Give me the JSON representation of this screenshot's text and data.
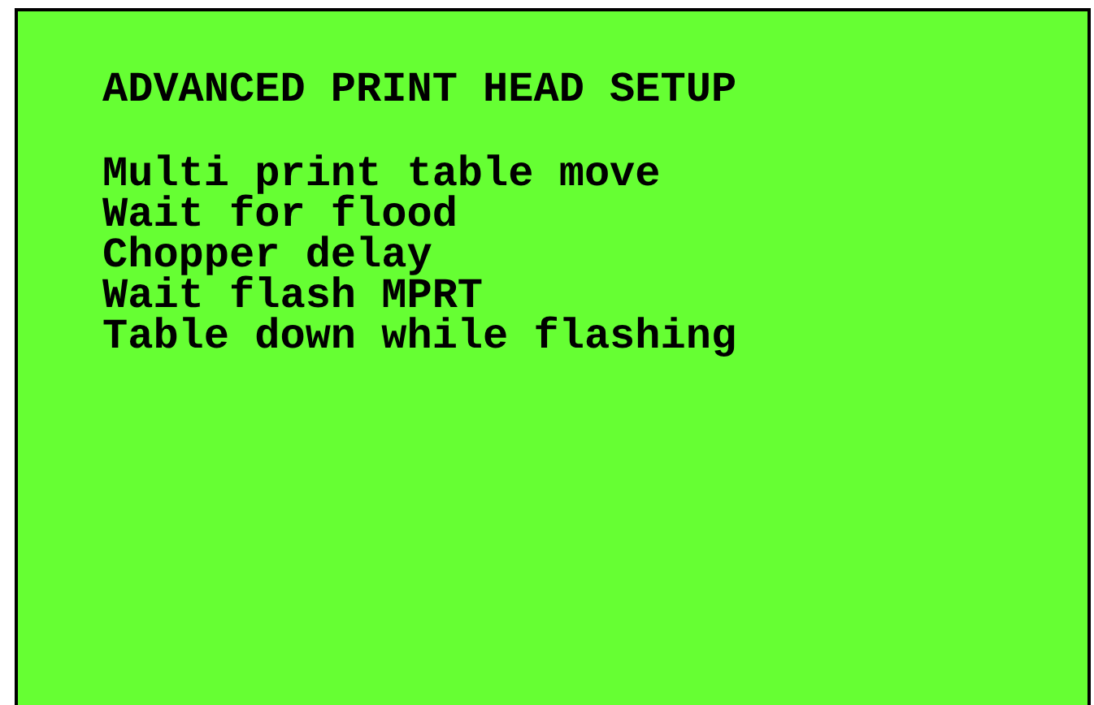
{
  "title": "ADVANCED PRINT HEAD SETUP",
  "items": [
    "Multi print table move",
    "Wait for flood",
    "Chopper delay",
    "Wait flash MPRT",
    "Table down while flashing"
  ]
}
